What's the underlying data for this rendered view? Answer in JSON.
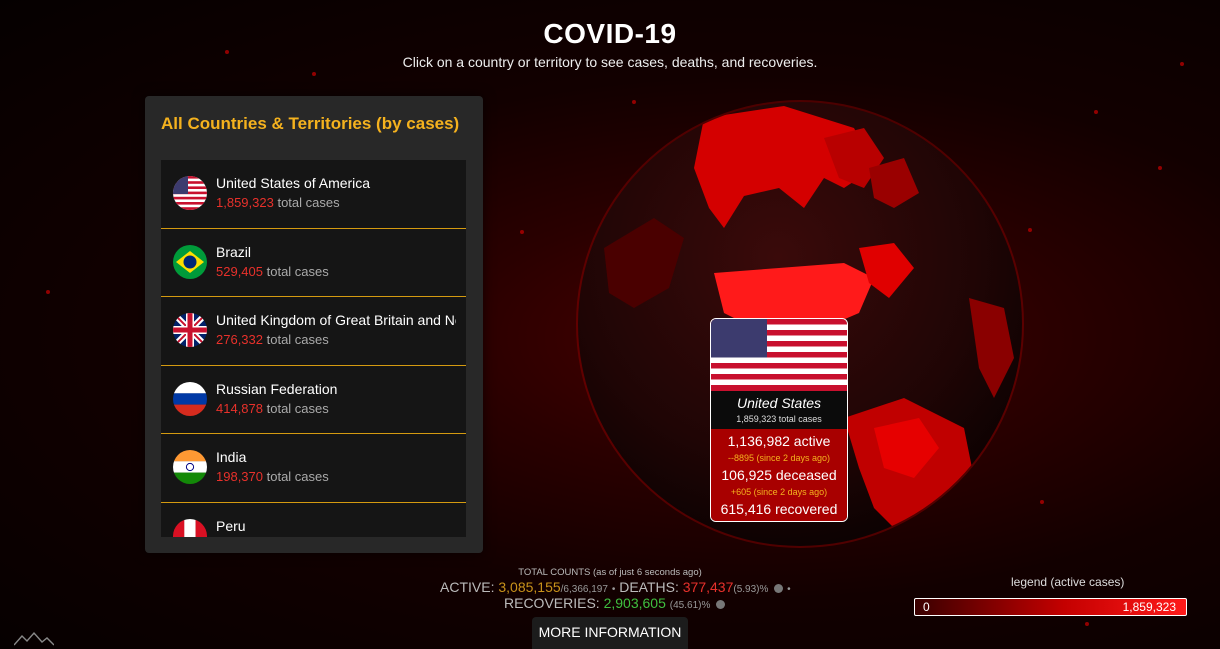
{
  "header": {
    "title": "COVID-19",
    "subtitle": "Click on a country or territory to see cases, deaths, and recoveries."
  },
  "panel": {
    "title": "All Countries & Territories (by cases)",
    "suffix": "total cases",
    "countries": [
      {
        "name": "United States of America",
        "cases": "1,859,323",
        "flag": "us-flag-icon"
      },
      {
        "name": "Brazil",
        "cases": "529,405",
        "flag": "brazil-flag-icon"
      },
      {
        "name": "United Kingdom of Great Britain and Northern Ireland",
        "cases": "276,332",
        "flag": "uk-flag-icon"
      },
      {
        "name": "Russian Federation",
        "cases": "414,878",
        "flag": "russia-flag-icon"
      },
      {
        "name": "India",
        "cases": "198,370",
        "flag": "india-flag-icon"
      },
      {
        "name": "Peru",
        "cases": "",
        "flag": "peru-flag-icon"
      }
    ]
  },
  "tooltip": {
    "country": "United States",
    "total": "1,859,323 total cases",
    "active": "1,136,982 active",
    "active_delta": "--8895 (since 2 days ago)",
    "deceased": "106,925 deceased",
    "deceased_delta": "+605 (since 2 days ago)",
    "recovered": "615,416 recovered"
  },
  "totals": {
    "heading": "TOTAL COUNTS (as of just 6 seconds ago)",
    "active_label": "ACTIVE:",
    "active_value": "3,085,155",
    "active_of": "/6,366,197",
    "deaths_label": "DEATHS:",
    "deaths_value": "377,437",
    "deaths_pct": "(5.93)%",
    "recoveries_label": "RECOVERIES:",
    "recoveries_value": "2,903,605",
    "recoveries_pct": "(45.61)%"
  },
  "more_info_label": "MORE INFORMATION",
  "legend": {
    "label": "legend (active cases)",
    "min": "0",
    "max": "1,859,323"
  },
  "colors": {
    "accent": "#f5b21e",
    "danger": "#e8312b",
    "recovery": "#3fbf3f",
    "globe_base": "#c40000"
  }
}
